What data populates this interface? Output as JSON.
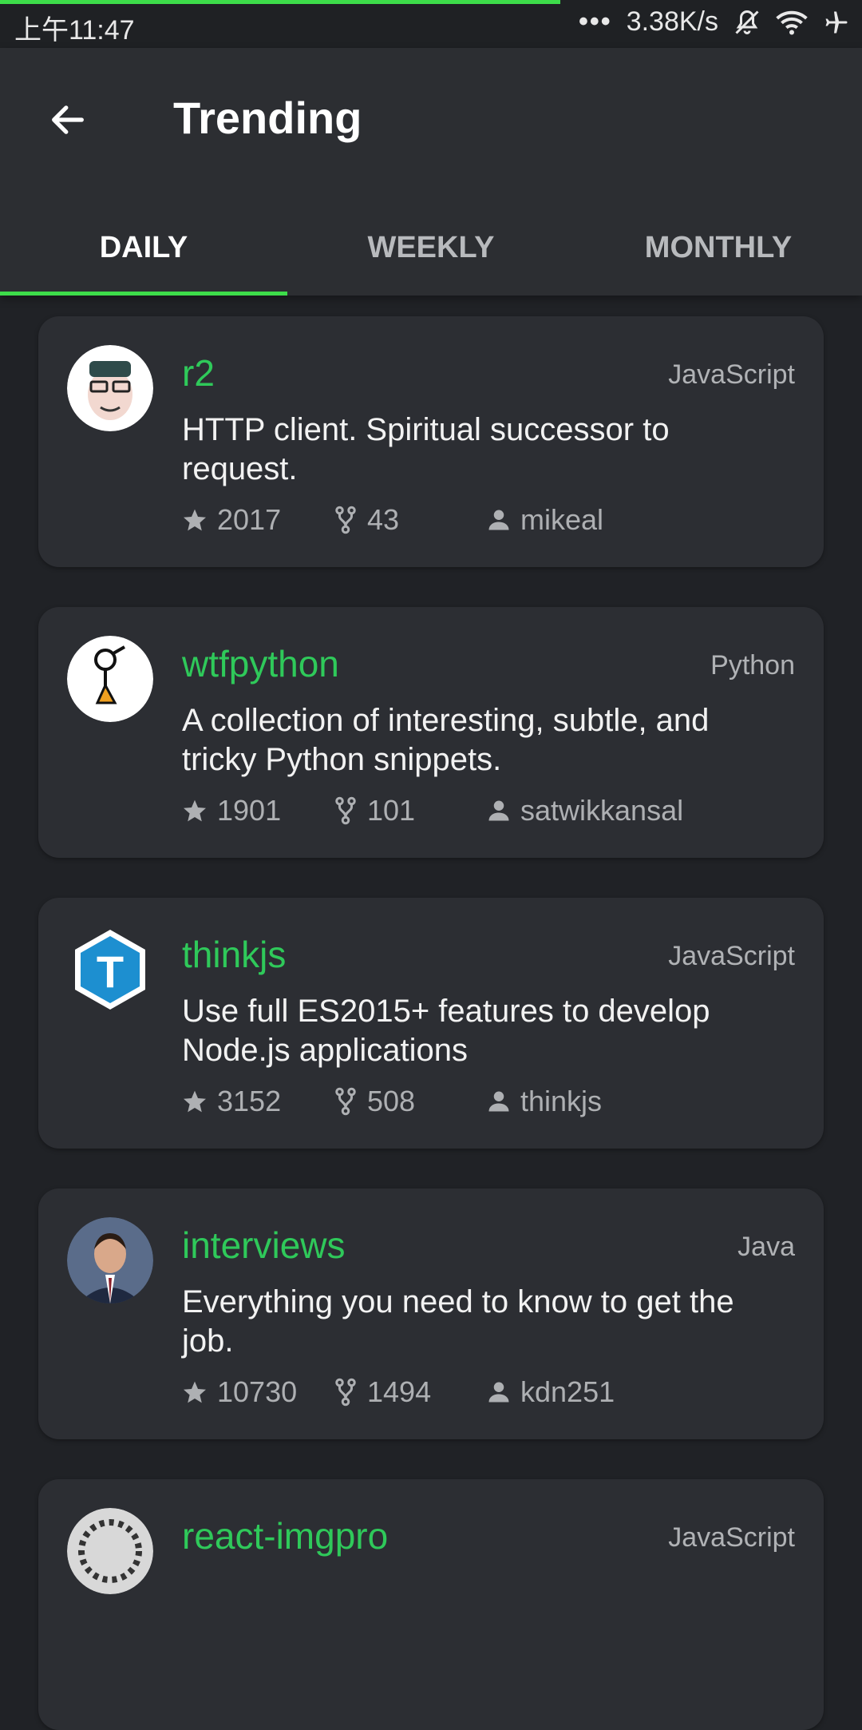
{
  "status_bar": {
    "time": "上午11:47",
    "signal_dots": "•••",
    "net_speed": "3.38K/s",
    "load_progress": 0.65
  },
  "app_bar": {
    "title": "Trending",
    "back_icon": "arrow-left-icon"
  },
  "tabs": [
    {
      "label": "DAILY",
      "active": true
    },
    {
      "label": "WEEKLY",
      "active": false
    },
    {
      "label": "MONTHLY",
      "active": false
    }
  ],
  "accent_color": "#3ddc4a",
  "repo_name_color": "#2fc95a",
  "repos": [
    {
      "name": "r2",
      "language": "JavaScript",
      "description": "HTTP client. Spiritual successor to request.",
      "stars": "2017",
      "forks": "43",
      "owner": "mikeal",
      "avatar": "cartoon-face-avatar"
    },
    {
      "name": "wtfpython",
      "language": "Python",
      "description": "A collection of interesting, subtle, and tricky Python snippets.",
      "stars": "1901",
      "forks": "101",
      "owner": "satwikkansal",
      "avatar": "bird-figure-avatar"
    },
    {
      "name": "thinkjs",
      "language": "JavaScript",
      "description": "Use full ES2015+ features to develop Node.js applications",
      "stars": "3152",
      "forks": "508",
      "owner": "thinkjs",
      "avatar": "hexagon-t-logo"
    },
    {
      "name": "interviews",
      "language": "Java",
      "description": "Everything you need to know to get the job.",
      "stars": "10730",
      "forks": "1494",
      "owner": "kdn251",
      "avatar": "person-photo-avatar"
    },
    {
      "name": "react-imgpro",
      "language": "JavaScript"
    }
  ]
}
